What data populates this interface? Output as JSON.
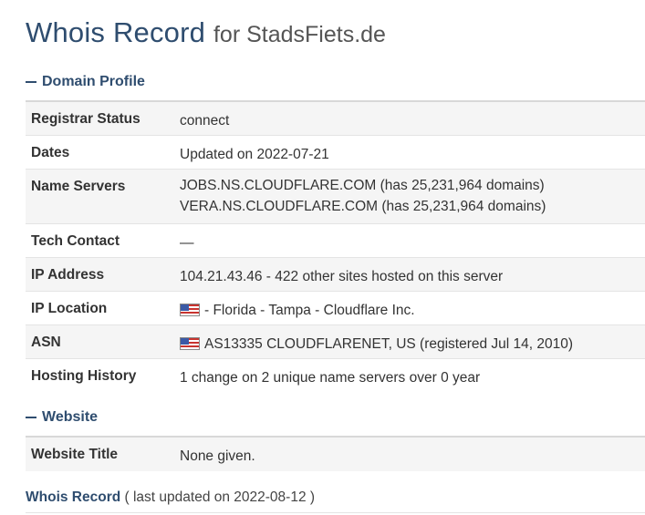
{
  "header": {
    "title": "Whois Record",
    "subtitle": "for StadsFiets.de"
  },
  "domain_profile": {
    "heading": "Domain Profile",
    "rows": [
      {
        "label": "Registrar Status",
        "values": [
          "connect"
        ]
      },
      {
        "label": "Dates",
        "values": [
          "Updated on 2022-07-21"
        ]
      },
      {
        "label": "Name Servers",
        "values": [
          "JOBS.NS.CLOUDFLARE.COM (has 25,231,964 domains)",
          "VERA.NS.CLOUDFLARE.COM (has 25,231,964 domains)"
        ]
      },
      {
        "label": "Tech Contact",
        "values": [
          "—"
        ]
      },
      {
        "label": "IP Address",
        "values": [
          "104.21.43.46 - 422 other sites hosted on this server"
        ]
      },
      {
        "label": "IP Location",
        "values": [
          "- Florida - Tampa - Cloudflare Inc."
        ],
        "flag": "us-flag-icon"
      },
      {
        "label": "ASN",
        "values": [
          "AS13335 CLOUDFLARENET, US (registered Jul 14, 2010)"
        ],
        "flag": "us-flag-icon"
      },
      {
        "label": "Hosting History",
        "values": [
          "1 change on 2 unique name servers over 0 year"
        ]
      }
    ]
  },
  "website": {
    "heading": "Website",
    "rows": [
      {
        "label": "Website Title",
        "values": [
          "None given."
        ]
      }
    ]
  },
  "footer": {
    "link": "Whois Record",
    "note": "( last updated on 2022-08-12 )"
  },
  "colors": {
    "accent": "#2f4d6f",
    "text": "#333333",
    "alt_row": "#f5f5f5"
  }
}
